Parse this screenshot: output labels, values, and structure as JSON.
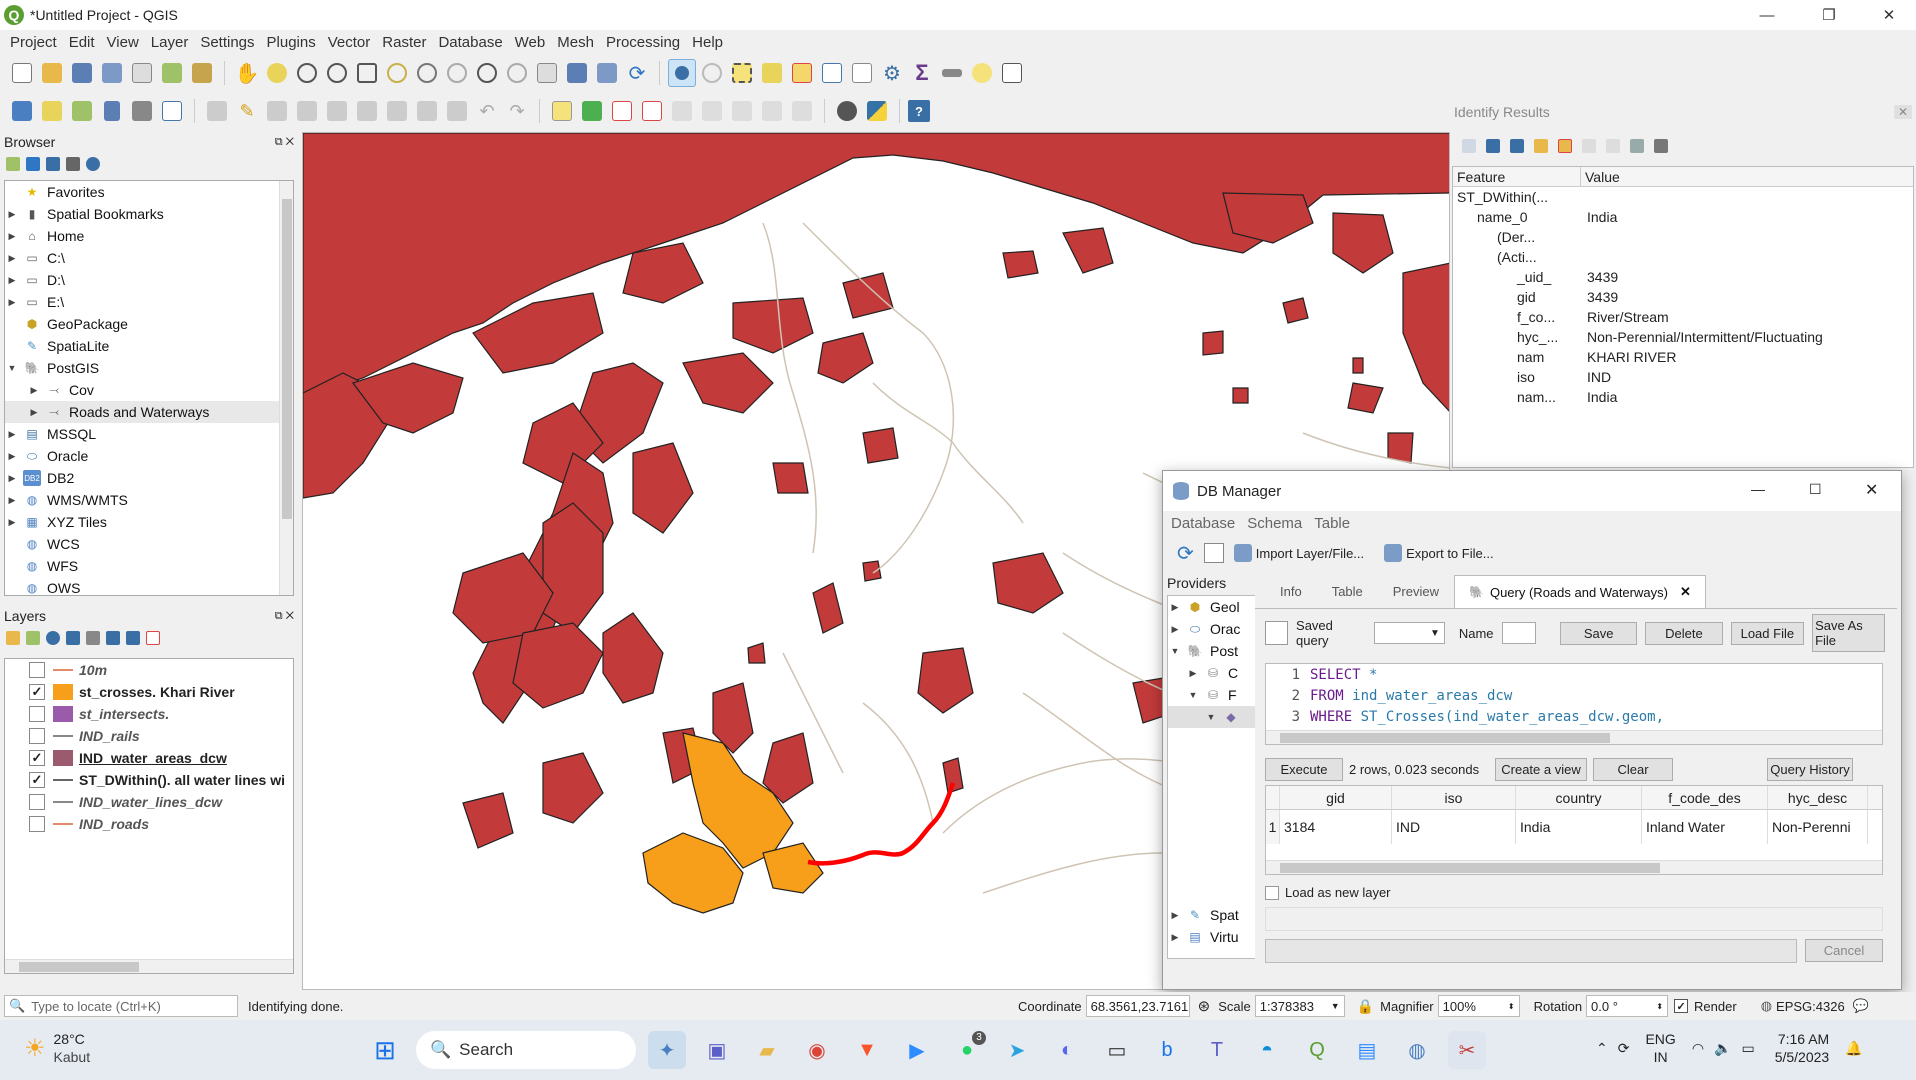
{
  "window": {
    "title": "*Untitled Project - QGIS"
  },
  "menubar": [
    "Project",
    "Edit",
    "View",
    "Layer",
    "Settings",
    "Plugins",
    "Vector",
    "Raster",
    "Database",
    "Web",
    "Mesh",
    "Processing",
    "Help"
  ],
  "colors": {
    "water_area": "#c23b3a",
    "crosses": "#f79f1a",
    "river_highlight": "#ff0000",
    "stream_lines": "#cfc4b4"
  },
  "browser": {
    "title": "Browser",
    "items": [
      {
        "label": "Favorites",
        "icon": "star-icon"
      },
      {
        "label": "Spatial Bookmarks",
        "icon": "bookmark-icon"
      },
      {
        "label": "Home",
        "icon": "home-icon"
      },
      {
        "label": "C:\\",
        "icon": "folder-icon"
      },
      {
        "label": "D:\\",
        "icon": "folder-icon"
      },
      {
        "label": "E:\\",
        "icon": "folder-icon"
      },
      {
        "label": "GeoPackage",
        "icon": "geopackage-icon"
      },
      {
        "label": "SpatiaLite",
        "icon": "spatialite-icon"
      },
      {
        "label": "PostGIS",
        "icon": "postgis-elephant-icon"
      },
      {
        "label": "Cov",
        "icon": "connection-icon"
      },
      {
        "label": "Roads and Waterways",
        "icon": "connection-icon"
      },
      {
        "label": "MSSQL",
        "icon": "mssql-icon"
      },
      {
        "label": "Oracle",
        "icon": "oracle-icon"
      },
      {
        "label": "DB2",
        "icon": "db2-icon"
      },
      {
        "label": "WMS/WMTS",
        "icon": "globe-icon"
      },
      {
        "label": "XYZ Tiles",
        "icon": "xyz-icon"
      },
      {
        "label": "WCS",
        "icon": "globe-icon"
      },
      {
        "label": "WFS",
        "icon": "globe-icon"
      },
      {
        "label": "OWS",
        "icon": "globe-icon"
      }
    ]
  },
  "layers": {
    "title": "Layers",
    "items": [
      {
        "label": "10m",
        "checked": false
      },
      {
        "label": "st_crosses. Khari River",
        "checked": true
      },
      {
        "label": "st_intersects.",
        "checked": false
      },
      {
        "label": "IND_rails",
        "checked": false
      },
      {
        "label": "IND_water_areas_dcw",
        "checked": true
      },
      {
        "label": "ST_DWithin(). all water lines wi",
        "checked": true
      },
      {
        "label": "IND_water_lines_dcw",
        "checked": false
      },
      {
        "label": "IND_roads",
        "checked": false
      }
    ]
  },
  "identify": {
    "title": "Identify Results",
    "headers": [
      "Feature",
      "Value"
    ],
    "rows": [
      {
        "f": "ST_DWithin(...",
        "v": ""
      },
      {
        "f": "name_0",
        "v": "India"
      },
      {
        "f": "(Der...",
        "v": ""
      },
      {
        "f": "(Acti...",
        "v": ""
      },
      {
        "f": "_uid_",
        "v": "3439"
      },
      {
        "f": "gid",
        "v": "3439"
      },
      {
        "f": "f_co...",
        "v": "River/Stream"
      },
      {
        "f": "hyc_...",
        "v": "Non-Perennial/Intermittent/Fluctuating"
      },
      {
        "f": "nam",
        "v": "KHARI RIVER"
      },
      {
        "f": "iso",
        "v": "IND"
      },
      {
        "f": "nam...",
        "v": "India"
      }
    ]
  },
  "dbmanager": {
    "title": "DB Manager",
    "menu": [
      "Database",
      "Schema",
      "Table"
    ],
    "import": "Import Layer/File...",
    "export": "Export to File...",
    "providers_label": "Providers",
    "providers": [
      "Geol",
      "Orac",
      "Post",
      "C",
      "F",
      "Spat",
      "Virtu"
    ],
    "tabs": [
      "Info",
      "Table",
      "Preview",
      "Query (Roads and Waterways)"
    ],
    "saved_query": "Saved query",
    "name": "Name",
    "save": "Save",
    "delete": "Delete",
    "load_file": "Load File",
    "save_as_file": "Save As File",
    "sql": [
      {
        "n": "1",
        "kw": "SELECT",
        "rest": " *"
      },
      {
        "n": "2",
        "kw": "FROM",
        "rest": " ind_water_areas_dcw"
      },
      {
        "n": "3",
        "kw": "WHERE",
        "rest": " ST_Crosses(ind_water_areas_dcw.geom,"
      }
    ],
    "execute": "Execute",
    "result_info": "2 rows, 0.023 seconds",
    "create_view": "Create a view",
    "clear": "Clear",
    "query_history": "Query History",
    "columns": [
      "gid",
      "iso",
      "country",
      "f_code_des",
      "hyc_desc"
    ],
    "rows": [
      {
        "num": "1",
        "cells": [
          "3184",
          "IND",
          "India",
          "Inland Water",
          "Non-Perenni"
        ]
      }
    ],
    "load_as_layer": "Load as new layer",
    "cancel": "Cancel"
  },
  "statusbar": {
    "locate_placeholder": "Type to locate (Ctrl+K)",
    "message": "Identifying done.",
    "coordinate_label": "Coordinate",
    "coordinate": "68.3561,23.7161",
    "scale_label": "Scale",
    "scale": "1:378383",
    "magnifier_label": "Magnifier",
    "magnifier": "100%",
    "rotation_label": "Rotation",
    "rotation": "0.0 °",
    "render": "Render",
    "crs": "EPSG:4326"
  },
  "taskbar": {
    "temp": "28°C",
    "location": "Kabut",
    "search": "Search",
    "lang1": "ENG",
    "lang2": "IN",
    "time": "7:16 AM",
    "date": "5/5/2023",
    "whatsapp_badge": "3"
  }
}
